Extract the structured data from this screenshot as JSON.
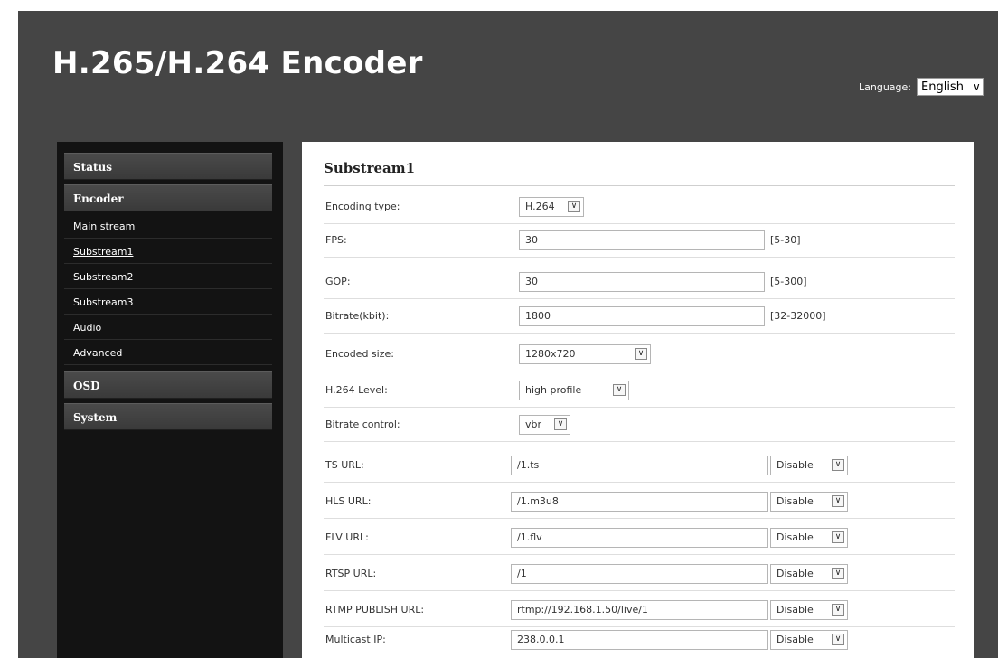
{
  "header": {
    "title": "H.265/H.264 Encoder",
    "language_label": "Language:",
    "language_value": "English"
  },
  "sidebar": {
    "sections": [
      {
        "label": "Status"
      },
      {
        "label": "Encoder"
      },
      {
        "label": "OSD"
      },
      {
        "label": "System"
      }
    ],
    "encoder_items": [
      {
        "label": "Main stream"
      },
      {
        "label": "Substream1"
      },
      {
        "label": "Substream2"
      },
      {
        "label": "Substream3"
      },
      {
        "label": "Audio"
      },
      {
        "label": "Advanced"
      }
    ]
  },
  "main": {
    "title": "Substream1",
    "encoding_type": {
      "label": "Encoding type:",
      "value": "H.264"
    },
    "fps": {
      "label": "FPS:",
      "value": "30",
      "range": "[5-30]"
    },
    "gop": {
      "label": "GOP:",
      "value": "30",
      "range": "[5-300]"
    },
    "bitrate": {
      "label": "Bitrate(kbit):",
      "value": "1800",
      "range": "[32-32000]"
    },
    "encoded_size": {
      "label": "Encoded size:",
      "value": "1280x720"
    },
    "h264_level": {
      "label": "H.264 Level:",
      "value": "high profile"
    },
    "bitrate_control": {
      "label": "Bitrate control:",
      "value": "vbr"
    },
    "ts_url": {
      "label": "TS URL:",
      "value": "/1.ts",
      "state": "Disable"
    },
    "hls_url": {
      "label": "HLS URL:",
      "value": "/1.m3u8",
      "state": "Disable"
    },
    "flv_url": {
      "label": "FLV URL:",
      "value": "/1.flv",
      "state": "Disable"
    },
    "rtsp_url": {
      "label": "RTSP URL:",
      "value": "/1",
      "state": "Disable"
    },
    "rtmp_url": {
      "label": "RTMP PUBLISH URL:",
      "value": "rtmp://192.168.1.50/live/1",
      "state": "Disable"
    },
    "multicast_ip": {
      "label": "Multicast IP:",
      "value": "238.0.0.1",
      "state": "Disable"
    }
  },
  "icons": {
    "dropdown": "chevron-down-icon"
  }
}
